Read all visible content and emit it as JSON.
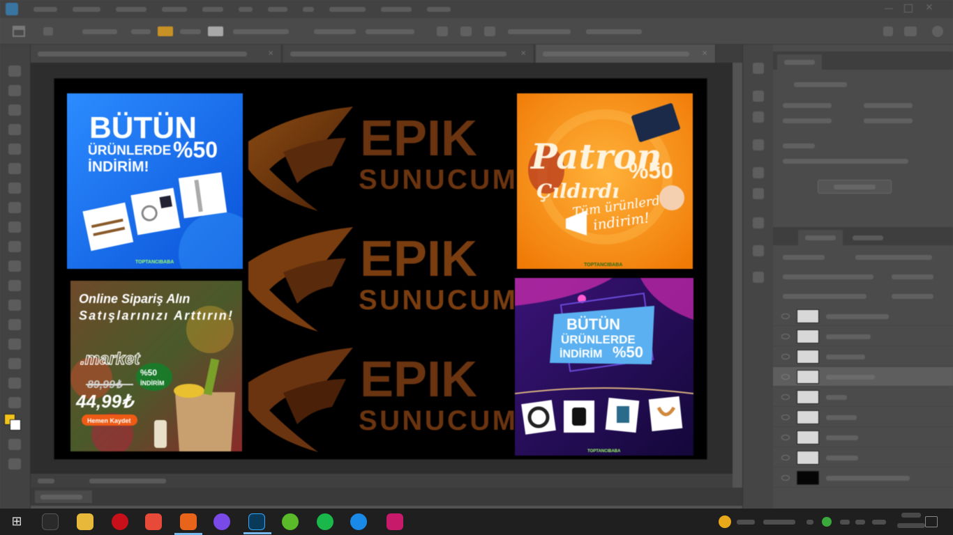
{
  "window": {
    "app": "Adobe Photoshop",
    "blurred": true
  },
  "canvas": {
    "background": "#000000",
    "center_logo": {
      "brand_top": "EPIK",
      "brand_bottom": "SUNUCUM",
      "repeat_count": 3,
      "color": "#6b3410"
    },
    "banners": [
      {
        "id": "blue",
        "headline_1": "BÜTÜN",
        "headline_2": "ÜRÜNLERDE",
        "headline_3": "İNDİRİM!",
        "discount": "%50",
        "brand": "TOPTANCIBABA",
        "bg": "#1878f0"
      },
      {
        "id": "orange",
        "headline_1": "Patron",
        "headline_2": "Çıldırdı",
        "discount": "%50",
        "sub_1": "Tüm ürünlerde",
        "sub_2": "indirim!",
        "brand": "TOPTANCIBABA",
        "bg": "#f58a0c"
      },
      {
        "id": "market",
        "headline_1": "Online Sipariş Alın",
        "headline_2": "Satışlarınızı Arttırın!",
        "domain": ".market",
        "old_price": "89,99₺",
        "new_price": "44,99₺",
        "badge_pct": "%50",
        "badge_text": "İNDİRİM",
        "cta": "Hemen Kaydet"
      },
      {
        "id": "purple",
        "headline_1": "BÜTÜN",
        "headline_2": "ÜRÜNLERDE",
        "headline_3": "İNDİRİM",
        "discount": "%50",
        "brand": "TOPTANCIBABA",
        "bg": "#2a1260"
      }
    ]
  },
  "panels": {
    "layer_count": 9,
    "selected_layer_index": 3
  },
  "colors": {
    "foreground": "#f2c31a",
    "background": "#ffffff",
    "accent": "#31a8ff"
  }
}
